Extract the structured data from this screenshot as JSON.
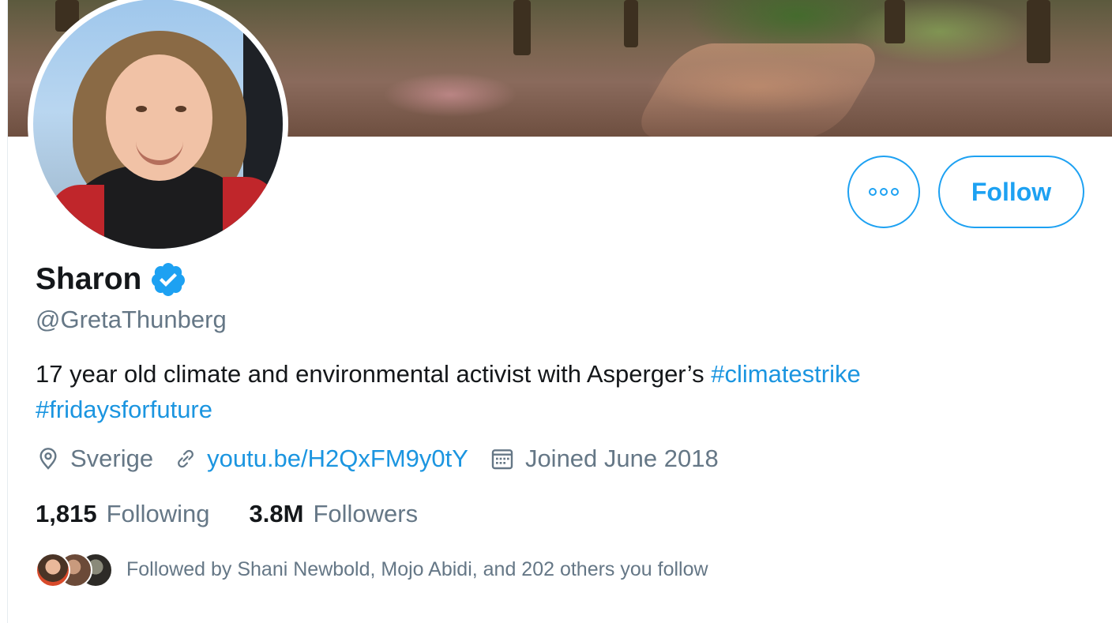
{
  "profile": {
    "name": "Sharon",
    "handle": "@GretaThunberg",
    "bio": {
      "text": "17 year old climate and environmental activist with Asperger’s ",
      "hashtags": [
        "#climatestrike",
        "#fridaysforfuture"
      ]
    },
    "location": "Sverige",
    "website": "youtu.be/H2QxFM9y0tY",
    "joined": "Joined June 2018"
  },
  "stats": {
    "following_count": "1,815",
    "following_label": "Following",
    "followers_count": "3.8M",
    "followers_label": "Followers"
  },
  "followed_by": {
    "text": "Followed by Shani Newbold, Mojo Abidi, and 202 others you follow"
  },
  "actions": {
    "follow_label": "Follow",
    "more_icon": "more-options-icon"
  },
  "colors": {
    "accent": "#1da1f2",
    "link": "#1b95e0",
    "secondary_text": "#657786",
    "primary_text": "#14171a"
  }
}
